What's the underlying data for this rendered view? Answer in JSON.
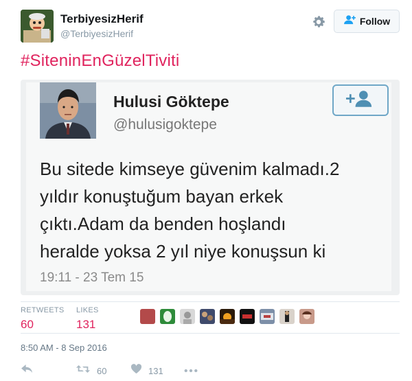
{
  "tweet": {
    "display_name": "TerbiyesizHerif",
    "handle": "@TerbiyesizHerif",
    "follow_label": "Follow",
    "hashtag": "#SiteninEnGüzelTiviti",
    "retweets_label": "RETWEETS",
    "retweets_value": "60",
    "likes_label": "LIKES",
    "likes_value": "131",
    "timestamp": "8:50 AM - 8 Sep 2016",
    "action_retweet_count": "60",
    "action_like_count": "131"
  },
  "embedded_tweet": {
    "name": "Hulusi Göktepe",
    "handle": "@hulusigoktepe",
    "text_lines": [
      "Bu sitede kimseye güvenim kalmadı.2",
      "yıldır konuştuğum bayan erkek",
      "çıktı.Adam da benden hoşlandı",
      "heralde yoksa 2 yıl niye konuşsun ki"
    ],
    "time": "19:11 - 23 Tem 15"
  },
  "colors": {
    "accent_pink": "#e0245e",
    "muted": "#8899a6",
    "divider": "#e1e8ed"
  },
  "icons": [
    "gear-icon",
    "follow-person-icon",
    "reply-icon",
    "retweet-icon",
    "heart-icon",
    "more-icon"
  ]
}
